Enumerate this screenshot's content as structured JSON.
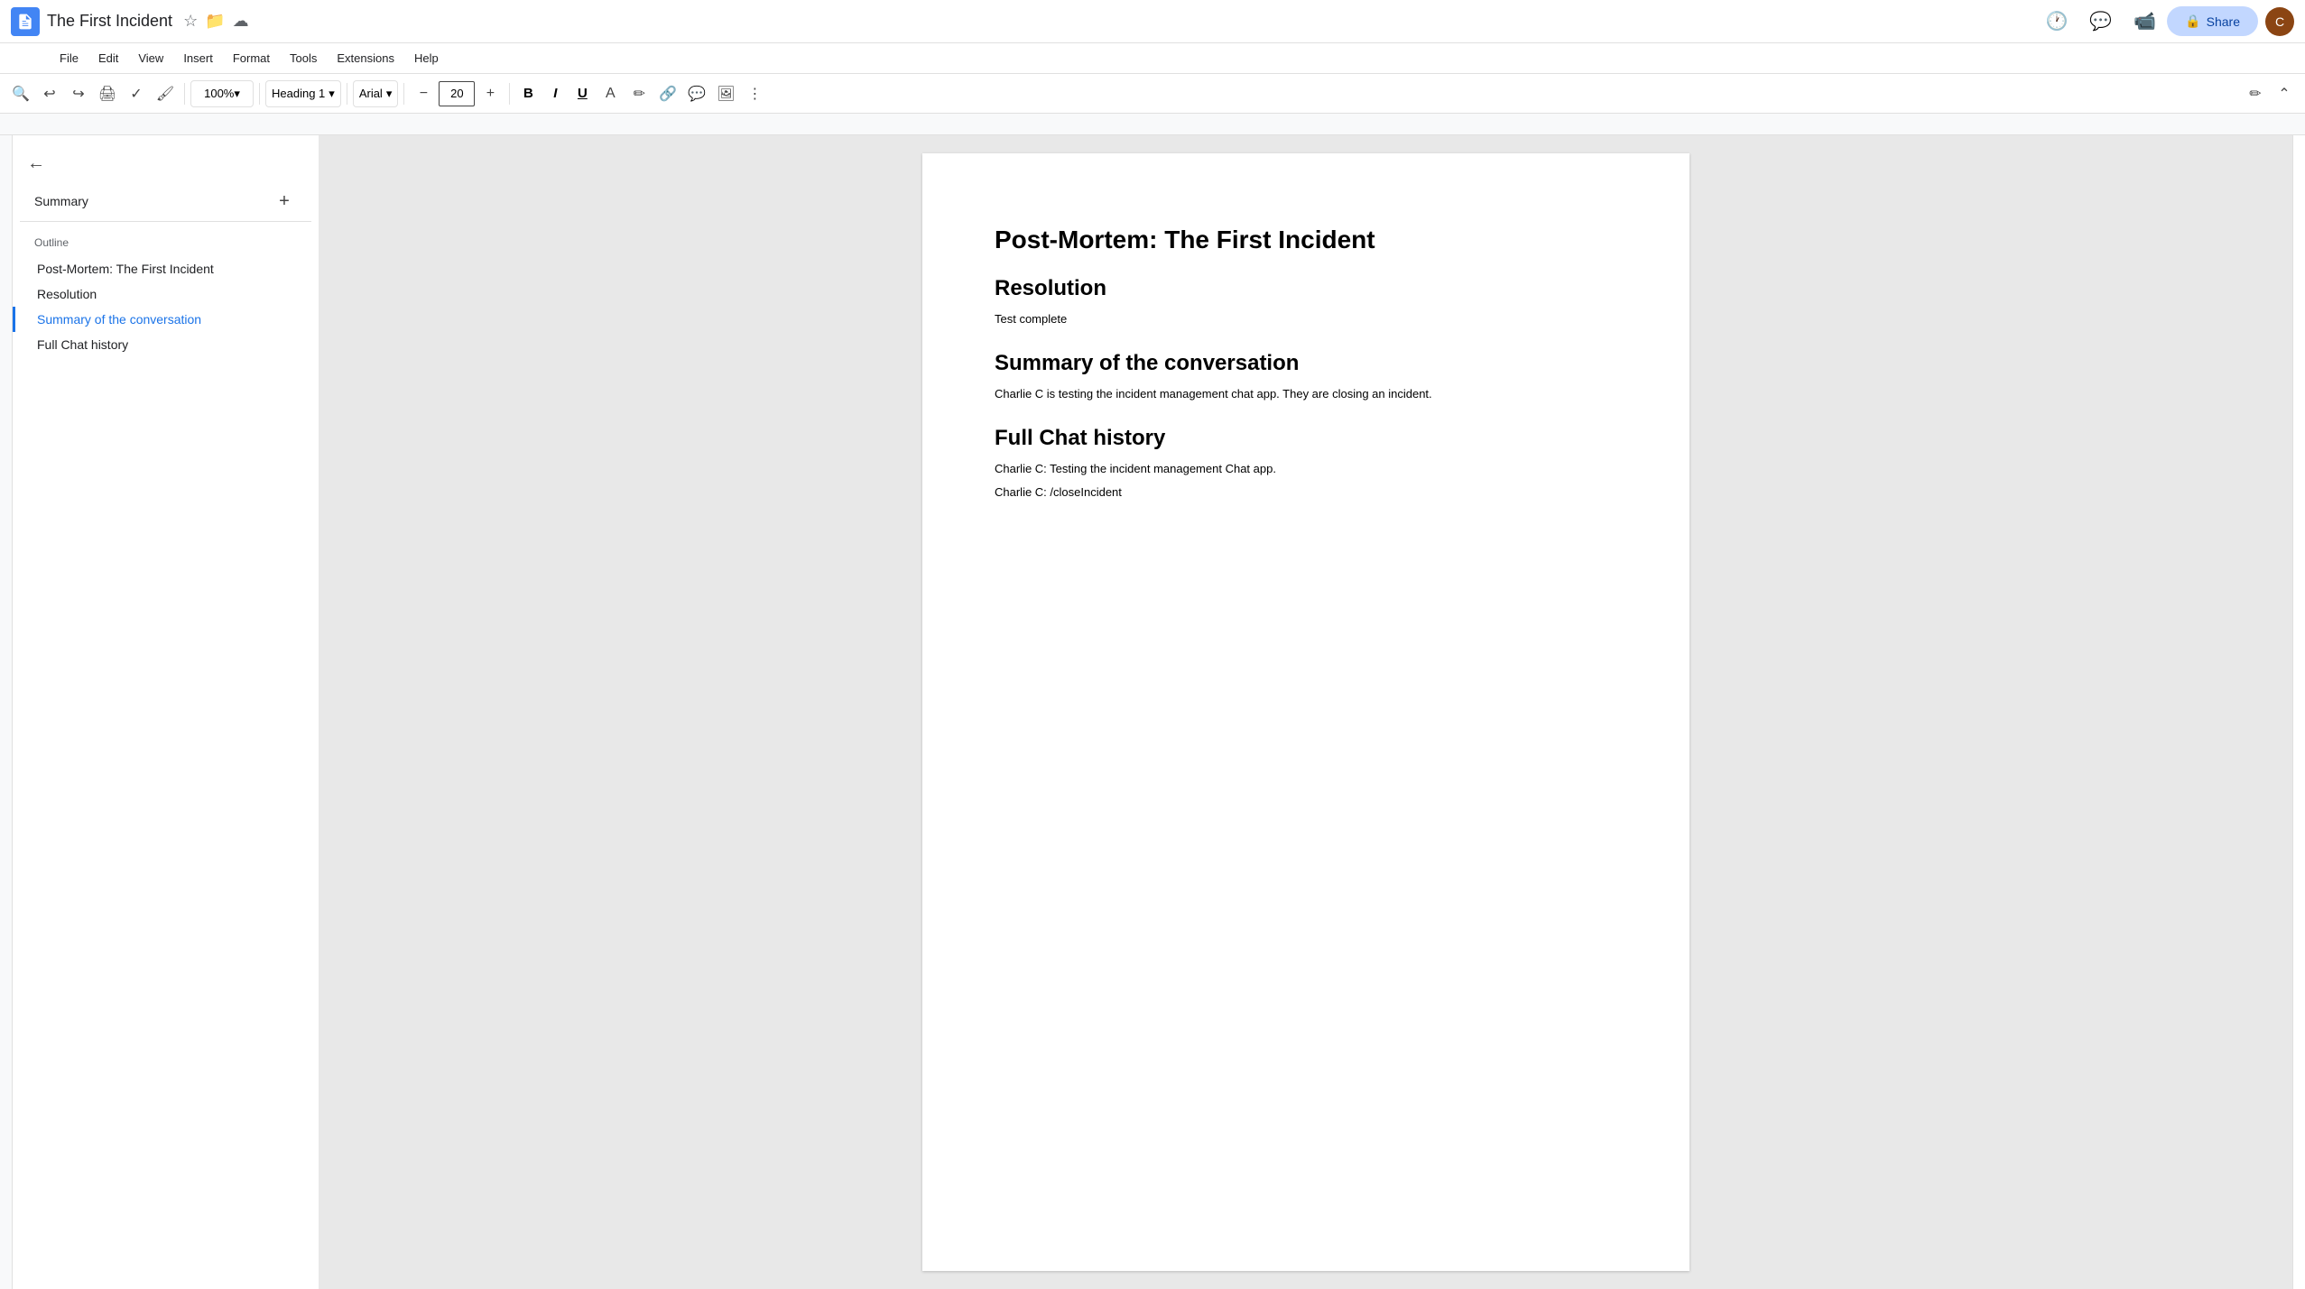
{
  "titleBar": {
    "docTitle": "The First Incident",
    "shareLabel": "Share"
  },
  "menuBar": {
    "items": [
      "File",
      "Edit",
      "View",
      "Insert",
      "Format",
      "Tools",
      "Extensions",
      "Help"
    ]
  },
  "toolbar": {
    "zoom": "100%",
    "zoomSuffix": "%",
    "headingStyle": "Heading 1",
    "fontFamily": "Arial",
    "fontSize": "20",
    "boldLabel": "B",
    "italicLabel": "I",
    "underlineLabel": "U"
  },
  "sidebar": {
    "summaryLabel": "Summary",
    "outlineLabel": "Outline",
    "outlineItems": [
      {
        "label": "Post-Mortem: The First Incident",
        "active": false
      },
      {
        "label": "Resolution",
        "active": false
      },
      {
        "label": "Summary of the conversation",
        "active": true
      },
      {
        "label": "Full Chat history",
        "active": false
      }
    ]
  },
  "document": {
    "title": "Post-Mortem: The First Incident",
    "sections": [
      {
        "heading": "Resolution",
        "body": [
          "Test complete"
        ]
      },
      {
        "heading": "Summary of the conversation",
        "body": [
          "Charlie C is testing the incident management chat app. They are closing an incident."
        ]
      },
      {
        "heading": "Full Chat history",
        "body": [
          "Charlie C: Testing the incident management Chat app.",
          "Charlie C: /closeIncident"
        ]
      }
    ]
  }
}
